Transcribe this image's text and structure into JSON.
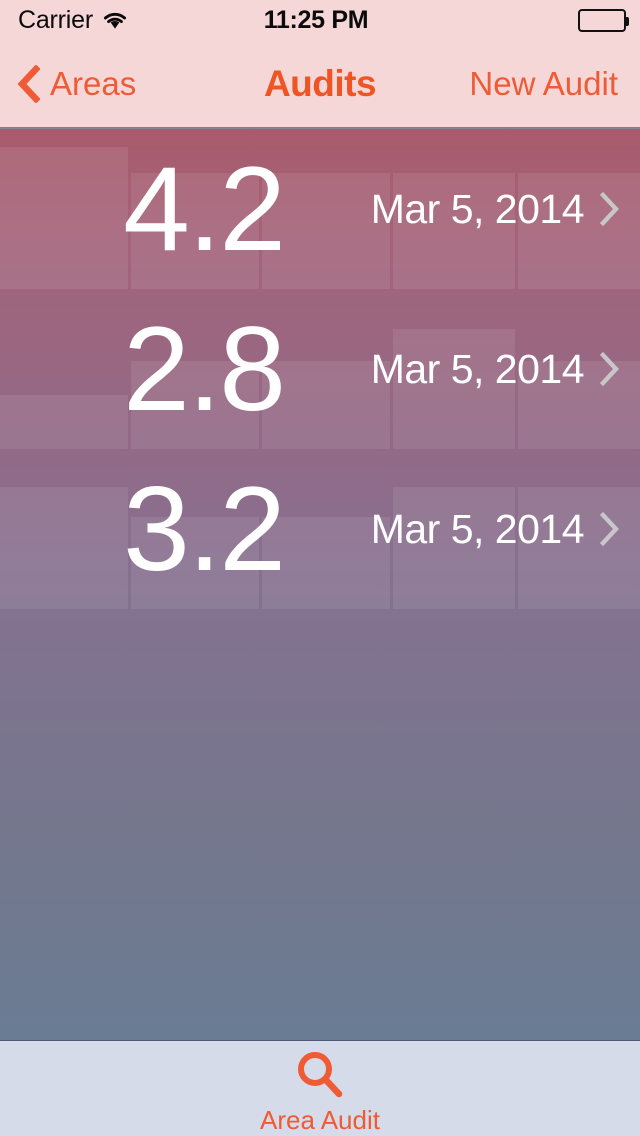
{
  "status_bar": {
    "carrier": "Carrier",
    "time": "11:25 PM",
    "wifi_icon": "wifi-icon",
    "battery_icon": "battery-full-icon"
  },
  "nav_bar": {
    "back_label": "Areas",
    "back_icon": "chevron-left-icon",
    "title": "Audits",
    "action_label": "New Audit"
  },
  "list": {
    "rows": [
      {
        "score": "4.2",
        "date": "Mar 5, 2014",
        "disclosure_icon": "chevron-right-icon"
      },
      {
        "score": "2.8",
        "date": "Mar 5, 2014",
        "disclosure_icon": "chevron-right-icon"
      },
      {
        "score": "3.2",
        "date": "Mar 5, 2014",
        "disclosure_icon": "chevron-right-icon"
      }
    ]
  },
  "tab_bar": {
    "items": [
      {
        "label": "Area Audit",
        "icon": "search-icon"
      }
    ]
  },
  "colors": {
    "accent": "#ef5b34",
    "nav_background": "#f6d7d8",
    "tab_background": "#d5dbe8",
    "content_top": "#a85b6c",
    "content_bottom": "#6a7c94",
    "row_text": "#ffffff",
    "disclosure": "#c9c6ca"
  }
}
